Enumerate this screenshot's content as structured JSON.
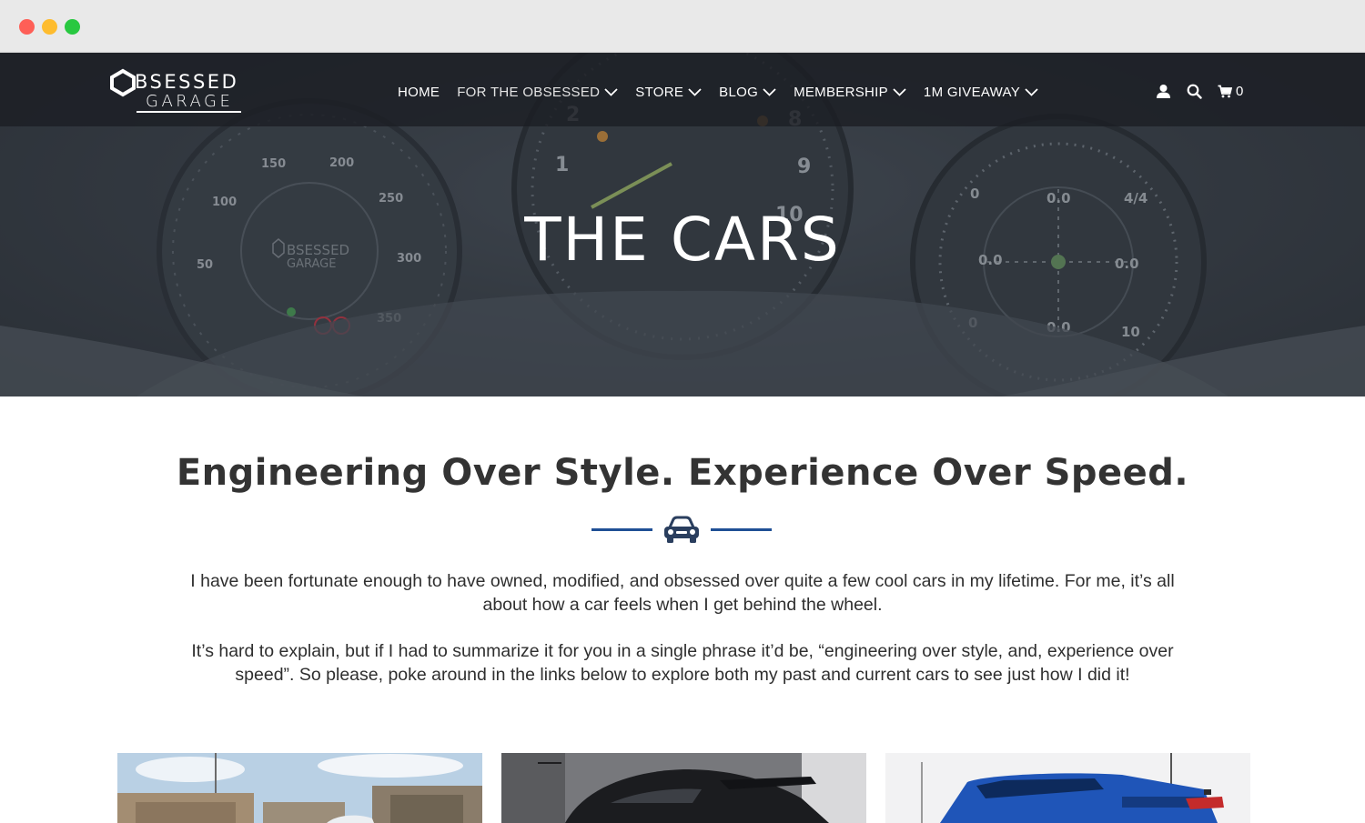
{
  "window": {
    "controls": [
      "close",
      "minimize",
      "maximize"
    ]
  },
  "brand": {
    "line1": "BSESSED",
    "line2": "GARAGE",
    "icon": "hexagon-o-logo-icon"
  },
  "nav": {
    "items": [
      {
        "label": "HOME",
        "dropdown": false
      },
      {
        "label": "FOR THE OBSESSED",
        "dropdown": true
      },
      {
        "label": "STORE",
        "dropdown": true
      },
      {
        "label": "BLOG",
        "dropdown": true
      },
      {
        "label": "MEMBERSHIP",
        "dropdown": true
      },
      {
        "label": "1M GIVEAWAY",
        "dropdown": true
      }
    ],
    "icons": [
      "user-icon",
      "search-icon",
      "cart-icon"
    ],
    "cart_count": "0"
  },
  "hero": {
    "title": "THE CARS",
    "background": "dashboard-gauges-photo",
    "gauge_numbers_left": [
      "50",
      "100",
      "150",
      "200",
      "250",
      "300",
      "350"
    ],
    "gauge_numbers_center": [
      "1",
      "2",
      "8",
      "9",
      "10"
    ],
    "gauge_readouts_right": [
      "0.0",
      "0.0",
      "0.0",
      "0.0",
      "4/4",
      "0",
      "0",
      "10"
    ]
  },
  "content": {
    "headline": "Engineering Over Style. Experience Over Speed.",
    "divider_icon": "car-front-icon",
    "paragraphs": [
      "I have been fortunate enough to have owned, modified, and obsessed over quite a few cool cars in my lifetime. For me, it’s all about how a car feels when I get behind the wheel.",
      "It’s hard to explain, but if I had to summarize it for you in a single phrase it’d be, “engineering over style, and, experience over speed”. So please, poke around in the links below to explore both my past and current cars to see just how I did it!"
    ]
  },
  "cards": [
    {
      "image": "white-car-buildings-photo"
    },
    {
      "image": "black-porsche-garage-photo"
    },
    {
      "image": "blue-ford-raptor-photo"
    }
  ],
  "colors": {
    "accent": "#1f4f95",
    "nav_bg": "#1c1f24",
    "text": "#2f2f2f"
  }
}
